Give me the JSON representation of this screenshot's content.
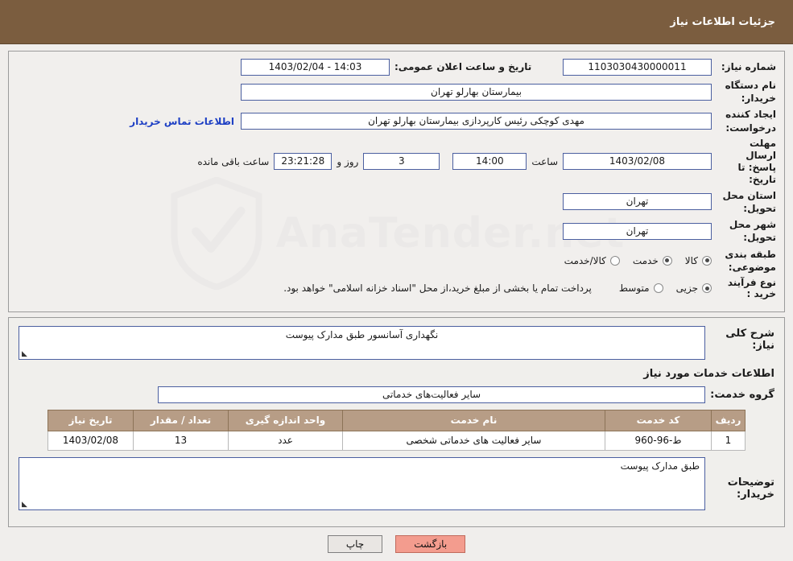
{
  "header": {
    "title": "جزئیات اطلاعات نیاز"
  },
  "watermark": {
    "text": "AnaTender.net",
    "icon": "shield-icon"
  },
  "form": {
    "need_number_label": "شماره نیاز:",
    "need_number_value": "1103030430000011",
    "announce_datetime_label": "تاریخ و ساعت اعلان عمومی:",
    "announce_datetime_value": "14:03 - 1403/02/04",
    "buyer_org_label": "نام دستگاه خریدار:",
    "buyer_org_value": "بیمارستان بهارلو تهران",
    "creator_label": "ایجاد کننده درخواست:",
    "creator_value": "مهدی کوچکی  رئیس کارپردازی بیمارستان بهارلو تهران",
    "contact_link": "اطلاعات تماس خریدار",
    "deadline_label": "مهلت ارسال پاسخ: تا تاریخ:",
    "deadline_date": "1403/02/08",
    "hour_label": "ساعت",
    "deadline_hour": "14:00",
    "days_value": "3",
    "days_label": "روز و",
    "remaining_value": "23:21:28",
    "remaining_label": "ساعت باقی مانده",
    "province_label": "استان محل تحویل:",
    "province_value": "تهران",
    "city_label": "شهر محل تحویل:",
    "city_value": "تهران",
    "category_label": "طبقه بندی موضوعی:",
    "category_options": [
      {
        "label": "کالا",
        "selected": true
      },
      {
        "label": "خدمت",
        "selected": true
      },
      {
        "label": "کالا/خدمت",
        "selected": false
      }
    ],
    "purchase_type_label": "نوع فرآیند خرید :",
    "purchase_type_options": [
      {
        "label": "جزیی",
        "selected": true
      },
      {
        "label": "متوسط",
        "selected": false
      }
    ],
    "purchase_note": "پرداخت تمام یا بخشی از مبلغ خرید،از محل \"اسناد خزانه اسلامی\" خواهد بود."
  },
  "details": {
    "general_desc_label": "شرح کلی نیاز:",
    "general_desc_value": "نگهداری آسانسور طبق مدارک پیوست",
    "services_section_title": "اطلاعات خدمات مورد نیاز",
    "service_group_label": "گروه خدمت:",
    "service_group_value": "سایر فعالیت‌های خدماتی",
    "table": {
      "columns": [
        "ردیف",
        "کد خدمت",
        "نام خدمت",
        "واحد اندازه گیری",
        "تعداد / مقدار",
        "تاریخ نیاز"
      ],
      "rows": [
        {
          "row": "1",
          "code": "ط-96-960",
          "name": "سایر فعالیت های خدماتی شخصی",
          "unit": "عدد",
          "qty": "13",
          "date": "1403/02/08"
        }
      ]
    },
    "buyer_notes_label": "توضیحات خریدار:",
    "buyer_notes_value": "طبق مدارک پیوست"
  },
  "footer": {
    "print_label": "چاپ",
    "back_label": "بازگشت"
  }
}
